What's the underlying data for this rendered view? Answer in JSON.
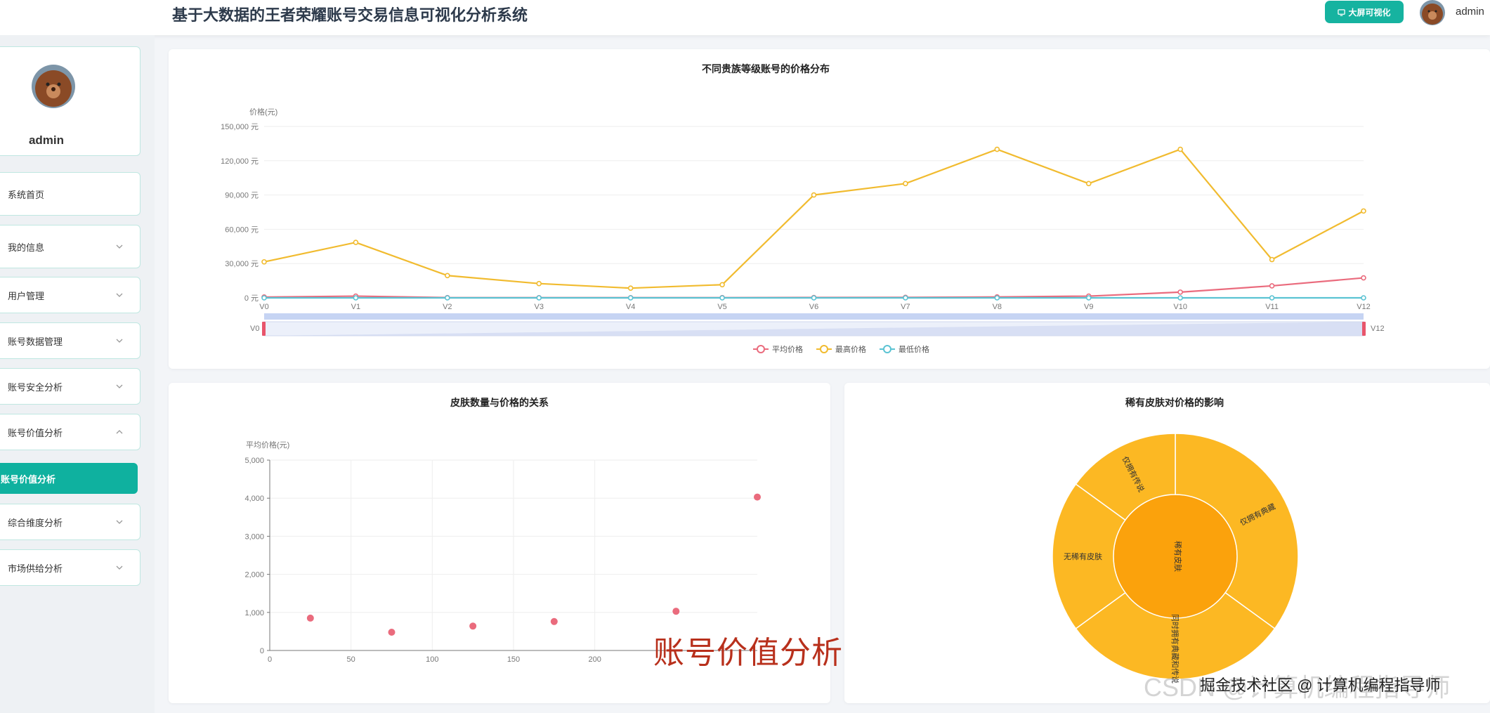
{
  "header": {
    "title": "基于大数据的王者荣耀账号交易信息可视化分析系统",
    "big_screen_button": "大屏可视化",
    "username": "admin"
  },
  "sidebar": {
    "profile_name": "admin",
    "items": [
      {
        "label": "系统首页",
        "has_chevron": false,
        "state": "normal"
      },
      {
        "label": "我的信息",
        "has_chevron": true,
        "state": "collapsed"
      },
      {
        "label": "用户管理",
        "has_chevron": true,
        "state": "collapsed"
      },
      {
        "label": "账号数据管理",
        "has_chevron": true,
        "state": "collapsed"
      },
      {
        "label": "账号安全分析",
        "has_chevron": true,
        "state": "collapsed"
      },
      {
        "label": "账号价值分析",
        "has_chevron": true,
        "state": "expanded"
      },
      {
        "label": "账号价值分析",
        "has_chevron": false,
        "state": "active"
      },
      {
        "label": "综合维度分析",
        "has_chevron": true,
        "state": "collapsed"
      },
      {
        "label": "市场供给分析",
        "has_chevron": true,
        "state": "collapsed"
      }
    ]
  },
  "colors": {
    "accent": "#0fb19f",
    "avg": "#ea6b7d",
    "max": "#f1bb2f",
    "min": "#5bc3d3",
    "sunburst_inner": "#fba20c",
    "sunburst_outer": "#fcb823"
  },
  "chart_data": [
    {
      "type": "line",
      "title": "不同贵族等级账号的价格分布",
      "ylabel": "价格(元)",
      "ylim": [
        0,
        150000
      ],
      "yticks": [
        "0 元",
        "30,000 元",
        "60,000 元",
        "90,000 元",
        "120,000 元",
        "150,000 元"
      ],
      "categories": [
        "V0",
        "V1",
        "V2",
        "V3",
        "V4",
        "V5",
        "V6",
        "V7",
        "V8",
        "V9",
        "V10",
        "V11",
        "V12"
      ],
      "series": [
        {
          "name": "平均价格",
          "values": [
            700,
            1500,
            200,
            150,
            150,
            200,
            300,
            400,
            800,
            1500,
            5000,
            10500,
            17500
          ]
        },
        {
          "name": "最高价格",
          "values": [
            31500,
            48500,
            19500,
            12500,
            8500,
            11500,
            90000,
            100000,
            130000,
            100000,
            130000,
            33500,
            76000
          ]
        },
        {
          "name": "最低价格",
          "values": [
            0,
            0,
            0,
            0,
            0,
            0,
            0,
            0,
            0,
            0,
            0,
            0,
            0
          ]
        }
      ],
      "datazoom": {
        "start": "V0",
        "end": "V12"
      },
      "legend_position": "bottom-center",
      "grid": true
    },
    {
      "type": "scatter",
      "title": "皮肤数量与价格的关系",
      "ylabel": "平均价格(元)",
      "xlim": [
        0,
        300
      ],
      "ylim": [
        0,
        5000
      ],
      "xticks": [
        "0",
        "50",
        "100",
        "150",
        "200"
      ],
      "yticks": [
        "0",
        "1,000",
        "2,000",
        "3,000",
        "4,000",
        "5,000"
      ],
      "points": [
        {
          "x": 25,
          "y": 850
        },
        {
          "x": 75,
          "y": 480
        },
        {
          "x": 125,
          "y": 640
        },
        {
          "x": 175,
          "y": 760
        },
        {
          "x": 250,
          "y": 1030
        },
        {
          "x": 300,
          "y": 4030
        }
      ],
      "grid": true
    },
    {
      "type": "pie",
      "subtype": "sunburst",
      "title": "稀有皮肤对价格的影响",
      "inner": [
        {
          "name": "稀有皮肤",
          "value": 100
        }
      ],
      "outer": [
        {
          "name": "仅拥有典藏",
          "value": 35
        },
        {
          "name": "同时拥有典藏和传说",
          "value": 30
        },
        {
          "name": "无稀有皮肤",
          "value": 20
        },
        {
          "name": "仅拥有传说",
          "value": 15
        }
      ]
    }
  ],
  "overlay_caption": "账号价值分析",
  "watermark": {
    "background_text": "CSDN @计算机编程指导师",
    "text": "掘金技术社区 @ 计算机编程指导师"
  }
}
